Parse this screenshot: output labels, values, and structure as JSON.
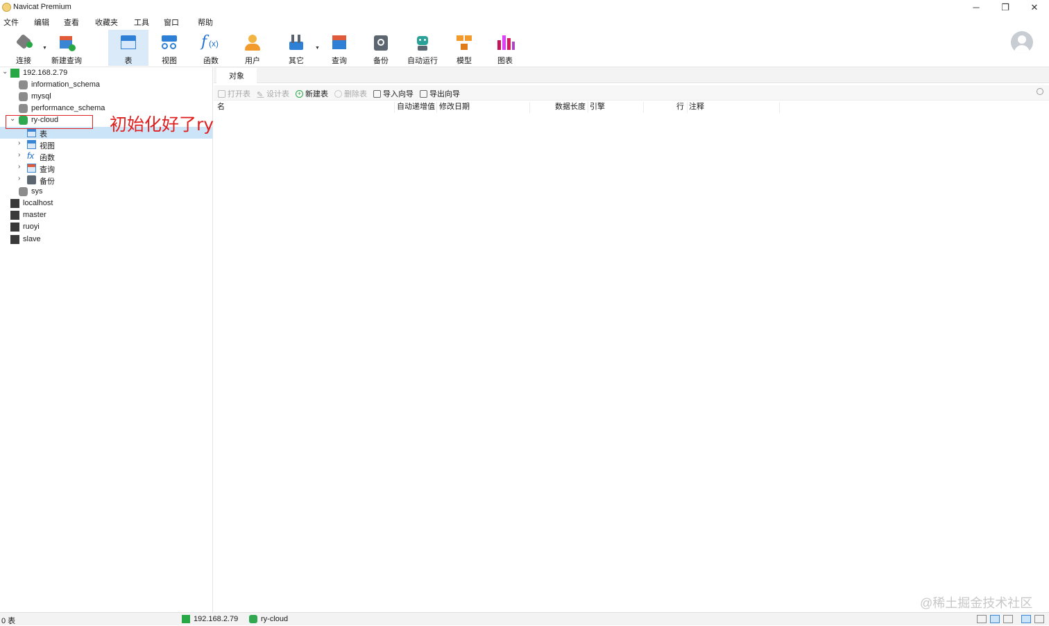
{
  "window": {
    "title": "Navicat Premium",
    "controls": {
      "minimize": "─",
      "restore": "❐",
      "close": "✕"
    }
  },
  "menu": [
    "文件",
    "编辑",
    "查看",
    "收藏夹",
    "工具",
    "窗口",
    "帮助"
  ],
  "toolbar": {
    "connect": "连接",
    "new_query": "新建查询",
    "table": "表",
    "view": "视图",
    "function": "函数",
    "user": "用户",
    "other": "其它",
    "query": "查询",
    "backup": "备份",
    "autorun": "自动运行",
    "model": "模型",
    "chart": "图表",
    "active": "表"
  },
  "tree": {
    "root": "192.168.2.79",
    "databases": [
      "information_schema",
      "mysql",
      "performance_schema"
    ],
    "selected_db": "ry-cloud",
    "children": {
      "table": "表",
      "view": "视图",
      "function": "函数",
      "query": "查询",
      "backup": "备份"
    },
    "sys": "sys",
    "connections": [
      "localhost",
      "master",
      "ruoyi",
      "slave"
    ]
  },
  "annotation": "初始化好了ry-cloud数据库",
  "tab": {
    "label": "对象"
  },
  "object_bar": {
    "open_table": "打开表",
    "design_table": "设计表",
    "new_table": "新建表",
    "delete_table": "删除表",
    "import_wizard": "导入向导",
    "export_wizard": "导出向导"
  },
  "columns": {
    "name": "名",
    "auto_increment": "自动递增值",
    "modified": "修改日期",
    "data_length": "数据长度",
    "engine": "引擎",
    "rows": "行",
    "comment": "注释"
  },
  "watermark": "@稀土掘金技术社区",
  "status": {
    "count": "0 表",
    "connection": "192.168.2.79",
    "database": "ry-cloud"
  },
  "colors": {
    "accent": "#cce4f7",
    "annotation": "#e02020",
    "green": "#2fa84f"
  }
}
